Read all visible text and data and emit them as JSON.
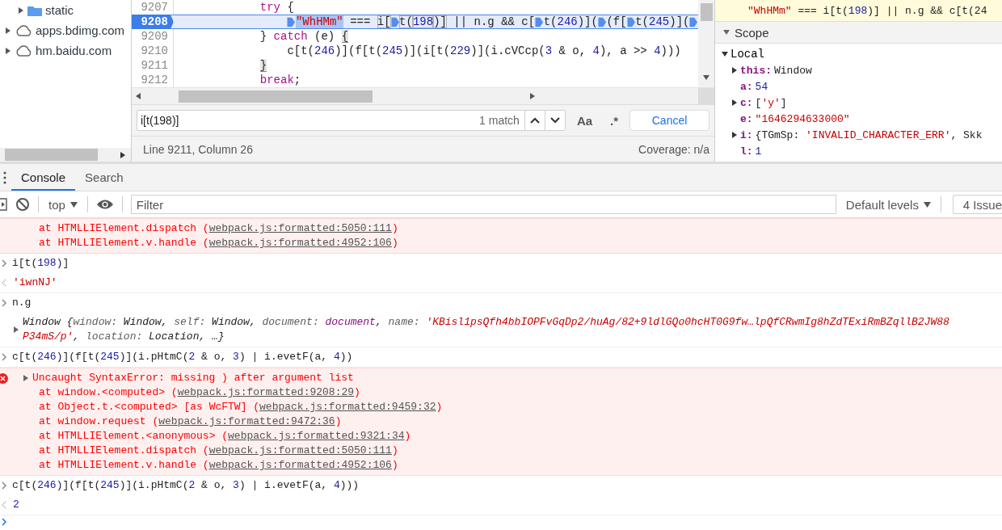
{
  "sidebar": {
    "items": [
      {
        "label": "static",
        "kind": "folder",
        "expanded": false
      },
      {
        "label": "apps.bdimg.com",
        "kind": "domain",
        "expanded": false
      },
      {
        "label": "hm.baidu.com",
        "kind": "domain",
        "expanded": false
      }
    ]
  },
  "editor": {
    "lines": [
      {
        "number": "9207",
        "current": false,
        "parts": [
          {
            "kind": "text",
            "tokens": [
              {
                "text": "try",
                "kind": "keyword"
              },
              {
                "text": " {",
                "kind": "plain"
              }
            ]
          }
        ],
        "children": [
          {
            "number": "9208",
            "current": true,
            "parts": [
              {
                "kind": "marker"
              },
              {
                "kind": "text",
                "tokens": [
                  {
                    "text": "\"WhHMm\"",
                    "kind": "sel-str"
                  },
                  {
                    "text": " === ",
                    "kind": "plain"
                  },
                  {
                    "text": "i[",
                    "kind": "match"
                  }
                ]
              },
              {
                "kind": "marker"
              },
              {
                "kind": "text",
                "tokens": [
                  {
                    "text": "t(",
                    "kind": "match"
                  },
                  {
                    "text": "198",
                    "kind": "match-num"
                  },
                  {
                    "text": ")]",
                    "kind": "match"
                  },
                  {
                    "text": " || n.g && c[",
                    "kind": "plain"
                  }
                ]
              },
              {
                "kind": "marker"
              },
              {
                "kind": "text",
                "tokens": [
                  {
                    "text": "t(",
                    "kind": "plain"
                  },
                  {
                    "text": "246",
                    "kind": "num"
                  },
                  {
                    "text": ")](",
                    "kind": "plain"
                  }
                ]
              },
              {
                "kind": "marker"
              },
              {
                "kind": "text",
                "tokens": [
                  {
                    "text": "(f[",
                    "kind": "plain"
                  }
                ]
              },
              {
                "kind": "marker"
              },
              {
                "kind": "text",
                "tokens": [
                  {
                    "text": "t(",
                    "kind": "plain"
                  },
                  {
                    "text": "245",
                    "kind": "num"
                  },
                  {
                    "text": ")](",
                    "kind": "plain"
                  }
                ]
              },
              {
                "kind": "marker"
              }
            ]
          }
        ]
      },
      {
        "number": "9209",
        "current": false,
        "parts": [
          {
            "kind": "text",
            "tokens": [
              {
                "text": "} ",
                "kind": "plain"
              },
              {
                "text": "catch",
                "kind": "keyword"
              },
              {
                "text": " (e) ",
                "kind": "plain"
              },
              {
                "text": "{",
                "kind": "bracket"
              }
            ]
          }
        ],
        "children": [
          {
            "number": "9210",
            "current": false,
            "parts": [
              {
                "kind": "text",
                "tokens": [
                  {
                    "text": "c[t(",
                    "kind": "plain"
                  },
                  {
                    "text": "246",
                    "kind": "num"
                  },
                  {
                    "text": ")](f[t(",
                    "kind": "plain"
                  },
                  {
                    "text": "245",
                    "kind": "num"
                  },
                  {
                    "text": ")](i[t(",
                    "kind": "plain"
                  },
                  {
                    "text": "229",
                    "kind": "num"
                  },
                  {
                    "text": ")](i.cVCcp(",
                    "kind": "plain"
                  },
                  {
                    "text": "3",
                    "kind": "num"
                  },
                  {
                    "text": " & o, ",
                    "kind": "plain"
                  },
                  {
                    "text": "4",
                    "kind": "num"
                  },
                  {
                    "text": "), a >> ",
                    "kind": "plain"
                  },
                  {
                    "text": "4",
                    "kind": "num"
                  },
                  {
                    "text": ")))",
                    "kind": "plain"
                  }
                ]
              }
            ]
          }
        ]
      },
      {
        "number": "9211",
        "current": false,
        "parts": [
          {
            "kind": "text",
            "tokens": [
              {
                "text": "}",
                "kind": "bracket"
              }
            ]
          }
        ]
      },
      {
        "number": "9212",
        "current": false,
        "parts": [
          {
            "kind": "text",
            "tokens": [
              {
                "text": "break",
                "kind": "keyword"
              },
              {
                "text": ";",
                "kind": "plain"
              }
            ]
          }
        ]
      }
    ],
    "search": {
      "value": "i[t(198)]",
      "matches": "1 match",
      "case_button": "Aa",
      "regex_button": ".*",
      "cancel": "Cancel"
    },
    "status": {
      "position": "Line 9211, Column 26",
      "coverage": "Coverage: n/a"
    }
  },
  "debugger": {
    "paused_line": [
      {
        "text": "\"WhHMm\"",
        "kind": "str"
      },
      {
        "text": " === i[t(",
        "kind": "plain"
      },
      {
        "text": "198",
        "kind": "num"
      },
      {
        "text": ")] || n.g && c[t(24",
        "kind": "plain"
      }
    ],
    "scope": {
      "title": "Scope",
      "expanded": true,
      "local": {
        "title": "Local",
        "expanded": true,
        "entries": [
          {
            "key": "this:",
            "expandable": true,
            "tokens": [
              {
                "text": "Window",
                "kind": "plain"
              }
            ]
          },
          {
            "key": "a:",
            "expandable": false,
            "tokens": [
              {
                "text": "54",
                "kind": "num"
              }
            ]
          },
          {
            "key": "c:",
            "expandable": true,
            "tokens": [
              {
                "text": "[",
                "kind": "plain"
              },
              {
                "text": "'y'",
                "kind": "str"
              },
              {
                "text": "]",
                "kind": "plain"
              }
            ]
          },
          {
            "key": "e:",
            "expandable": false,
            "tokens": [
              {
                "text": "\"1646294633000\"",
                "kind": "str"
              }
            ]
          },
          {
            "key": "i:",
            "expandable": true,
            "tokens": [
              {
                "text": "{TGmSp: ",
                "kind": "plain"
              },
              {
                "text": "'INVALID_CHARACTER_ERR'",
                "kind": "str"
              },
              {
                "text": ", Skk",
                "kind": "plain"
              }
            ]
          },
          {
            "key": "l:",
            "expandable": false,
            "tokens": [
              {
                "text": "1",
                "kind": "num"
              }
            ]
          }
        ]
      }
    }
  },
  "drawer": {
    "tabs": [
      {
        "label": "Console",
        "selected": true
      },
      {
        "label": "Search",
        "selected": false
      }
    ],
    "toolbar": {
      "context": "top",
      "filter_placeholder": "Filter",
      "levels": "Default levels",
      "issues": "4 Issue"
    },
    "messages": [
      {
        "kind": "trace",
        "stack": [
          {
            "before": "at HTMLLIElement.dispatch (",
            "link": "webpack.js:formatted:5050:111",
            "after": ")"
          },
          {
            "before": "at HTMLLIElement.v.handle (",
            "link": "webpack.js:formatted:4952:106",
            "after": ")"
          }
        ]
      },
      {
        "kind": "input",
        "tokens": [
          {
            "text": "i[t(",
            "kind": "plain"
          },
          {
            "text": "198",
            "kind": "num"
          },
          {
            "text": ")]",
            "kind": "plain"
          }
        ]
      },
      {
        "kind": "result",
        "tokens": [
          {
            "text": "'iwnNJ'",
            "kind": "str"
          }
        ]
      },
      {
        "kind": "input",
        "tokens": [
          {
            "text": "n.g",
            "kind": "plain"
          }
        ]
      },
      {
        "kind": "object",
        "expanded": false,
        "lines": [
          [
            {
              "text": "Window {",
              "kind": "plain"
            },
            {
              "text": "window: ",
              "kind": "key"
            },
            {
              "text": "Window, ",
              "kind": "plain"
            },
            {
              "text": "self: ",
              "kind": "key"
            },
            {
              "text": "Window, ",
              "kind": "plain"
            },
            {
              "text": "document: ",
              "kind": "key"
            },
            {
              "text": "document",
              "kind": "node"
            },
            {
              "text": ", ",
              "kind": "plain"
            },
            {
              "text": "name: ",
              "kind": "key"
            },
            {
              "text": "'KBisl1psQfh4bbIOPFvGqDp2/huAg/82+9ldlGQo0hcHT0G9fw…lpQfCRwmIg8hZdTExiRmBZqllB2JW88",
              "kind": "str"
            }
          ],
          [
            {
              "text": "P34mS/p'",
              "kind": "str"
            },
            {
              "text": ", ",
              "kind": "plain"
            },
            {
              "text": "location: ",
              "kind": "key"
            },
            {
              "text": "Location, …}",
              "kind": "plain"
            }
          ]
        ]
      },
      {
        "kind": "input",
        "tokens": [
          {
            "text": "c[t(",
            "kind": "plain"
          },
          {
            "text": "246",
            "kind": "num"
          },
          {
            "text": ")](f[t(",
            "kind": "plain"
          },
          {
            "text": "245",
            "kind": "num"
          },
          {
            "text": ")](i.pHtmC(",
            "kind": "plain"
          },
          {
            "text": "2",
            "kind": "num"
          },
          {
            "text": " & o, ",
            "kind": "plain"
          },
          {
            "text": "3",
            "kind": "num"
          },
          {
            "text": ") | i.evetF(a, ",
            "kind": "plain"
          },
          {
            "text": "4",
            "kind": "num"
          },
          {
            "text": "))",
            "kind": "plain"
          }
        ]
      },
      {
        "kind": "error",
        "expanded": false,
        "title": "Uncaught SyntaxError: missing ) after argument list",
        "stack": [
          {
            "before": "at window.<computed> (",
            "link": "webpack.js:formatted:9208:29",
            "after": ")"
          },
          {
            "before": "at Object.t.<computed> [as WcFTW] (",
            "link": "webpack.js:formatted:9459:32",
            "after": ")"
          },
          {
            "before": "at window.request (",
            "link": "webpack.js:formatted:9472:36",
            "after": ")"
          },
          {
            "before": "at HTMLLIElement.<anonymous> (",
            "link": "webpack.js:formatted:9321:34",
            "after": ")"
          },
          {
            "before": "at HTMLLIElement.dispatch (",
            "link": "webpack.js:formatted:5050:111",
            "after": ")"
          },
          {
            "before": "at HTMLLIElement.v.handle (",
            "link": "webpack.js:formatted:4952:106",
            "after": ")"
          }
        ]
      },
      {
        "kind": "input",
        "tokens": [
          {
            "text": "c[t(",
            "kind": "plain"
          },
          {
            "text": "246",
            "kind": "num"
          },
          {
            "text": ")](f[t(",
            "kind": "plain"
          },
          {
            "text": "245",
            "kind": "num"
          },
          {
            "text": ")](i.pHtmC(",
            "kind": "plain"
          },
          {
            "text": "2",
            "kind": "num"
          },
          {
            "text": " & o, ",
            "kind": "plain"
          },
          {
            "text": "3",
            "kind": "num"
          },
          {
            "text": ") | i.evetF(a, ",
            "kind": "plain"
          },
          {
            "text": "4",
            "kind": "num"
          },
          {
            "text": ")))",
            "kind": "plain"
          }
        ]
      },
      {
        "kind": "result",
        "tokens": [
          {
            "text": "2",
            "kind": "num"
          }
        ]
      },
      {
        "kind": "prompt"
      }
    ]
  }
}
